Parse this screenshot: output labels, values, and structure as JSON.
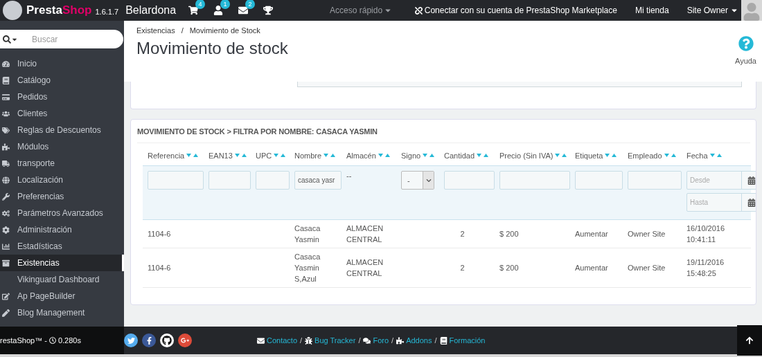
{
  "topbar": {
    "brand": [
      "Presta",
      "Shop"
    ],
    "version": "1.6.1.7",
    "shop": "Belardona",
    "notifications": [
      {
        "count": "4"
      },
      {
        "count": "1"
      },
      {
        "count": "2"
      }
    ],
    "quick_access": "Acceso rápido",
    "marketplace": "Conectar con su cuenta de PrestaShop Marketplace",
    "my_store": "Mi tienda",
    "user": "Site Owner"
  },
  "sidebar": {
    "search": {
      "placeholder": "Buscar"
    },
    "items": [
      {
        "label": "Inicio",
        "selected": false
      },
      {
        "label": "Catálogo",
        "selected": false
      },
      {
        "label": "Pedidos",
        "selected": false
      },
      {
        "label": "Clientes",
        "selected": false
      },
      {
        "label": "Reglas de Descuentos",
        "selected": false
      },
      {
        "label": "Módulos",
        "selected": false
      },
      {
        "label": "transporte",
        "selected": false
      },
      {
        "label": "Localización",
        "selected": false
      },
      {
        "label": "Preferencias",
        "selected": false
      },
      {
        "label": "Parámetros Avanzados",
        "selected": false
      },
      {
        "label": "Administración",
        "selected": false
      },
      {
        "label": "Estadísticas",
        "selected": false
      },
      {
        "label": "Existencias",
        "selected": true
      },
      {
        "label": "Vikinguard Dashboard",
        "selected": false
      },
      {
        "label": "Ap PageBuilder",
        "selected": false
      },
      {
        "label": "Blog Management",
        "selected": false
      }
    ]
  },
  "header": {
    "breadcrumb": {
      "items": [
        "Existencias",
        "Movimiento de Stock"
      ],
      "separator": "/"
    },
    "title": "Movimiento de stock",
    "help": "Ayuda"
  },
  "panel": {
    "title": "MOVIMIENTO DE STOCK > FILTRA POR NOMBRE: CASACA YASMIN",
    "table": {
      "columns": [
        "Referencia",
        "EAN13",
        "UPC",
        "Nombre",
        "Almacén",
        "Signo",
        "Cantidad",
        "Precio (Sin IVA)",
        "Etiqueta",
        "Empleado",
        "Fecha"
      ],
      "filters": [
        {
          "kind": "input"
        },
        {
          "kind": "input"
        },
        {
          "kind": "input"
        },
        {
          "kind": "input",
          "value": "casaca yasr"
        },
        {
          "kind": "text",
          "value": "--"
        },
        {
          "kind": "select",
          "value": "-"
        },
        {
          "kind": "input"
        },
        {
          "kind": "input"
        },
        {
          "kind": "input"
        },
        {
          "kind": "input"
        },
        {
          "kind": "dates",
          "fields": [
            {
              "placeholder": "Desde"
            },
            {
              "placeholder": "Hasta"
            }
          ]
        }
      ],
      "rows": [
        [
          "1104-6",
          "",
          "",
          "Casaca Yasmin",
          "ALMACEN CENTRAL",
          "",
          "2",
          "$ 200",
          "Aumentar",
          "Owner Site",
          "16/10/2016 10:41:11"
        ],
        [
          "1104-6",
          "",
          "",
          "Casaca Yasmin S,Azul",
          "ALMACEN CENTRAL",
          "",
          "2",
          "$ 200",
          "Aumentar",
          "Owner Site",
          "19/11/2016 15:48:25"
        ]
      ]
    }
  },
  "footer": {
    "brand": "restaShop™ -",
    "time": "0.280s",
    "links": [
      {
        "label": "Contacto",
        "separator": "/"
      },
      {
        "label": "Bug Tracker",
        "separator": "/"
      },
      {
        "label": "Foro",
        "separator": "/"
      },
      {
        "label": "Addons",
        "separator": "/"
      },
      {
        "label": "Formación"
      }
    ]
  }
}
